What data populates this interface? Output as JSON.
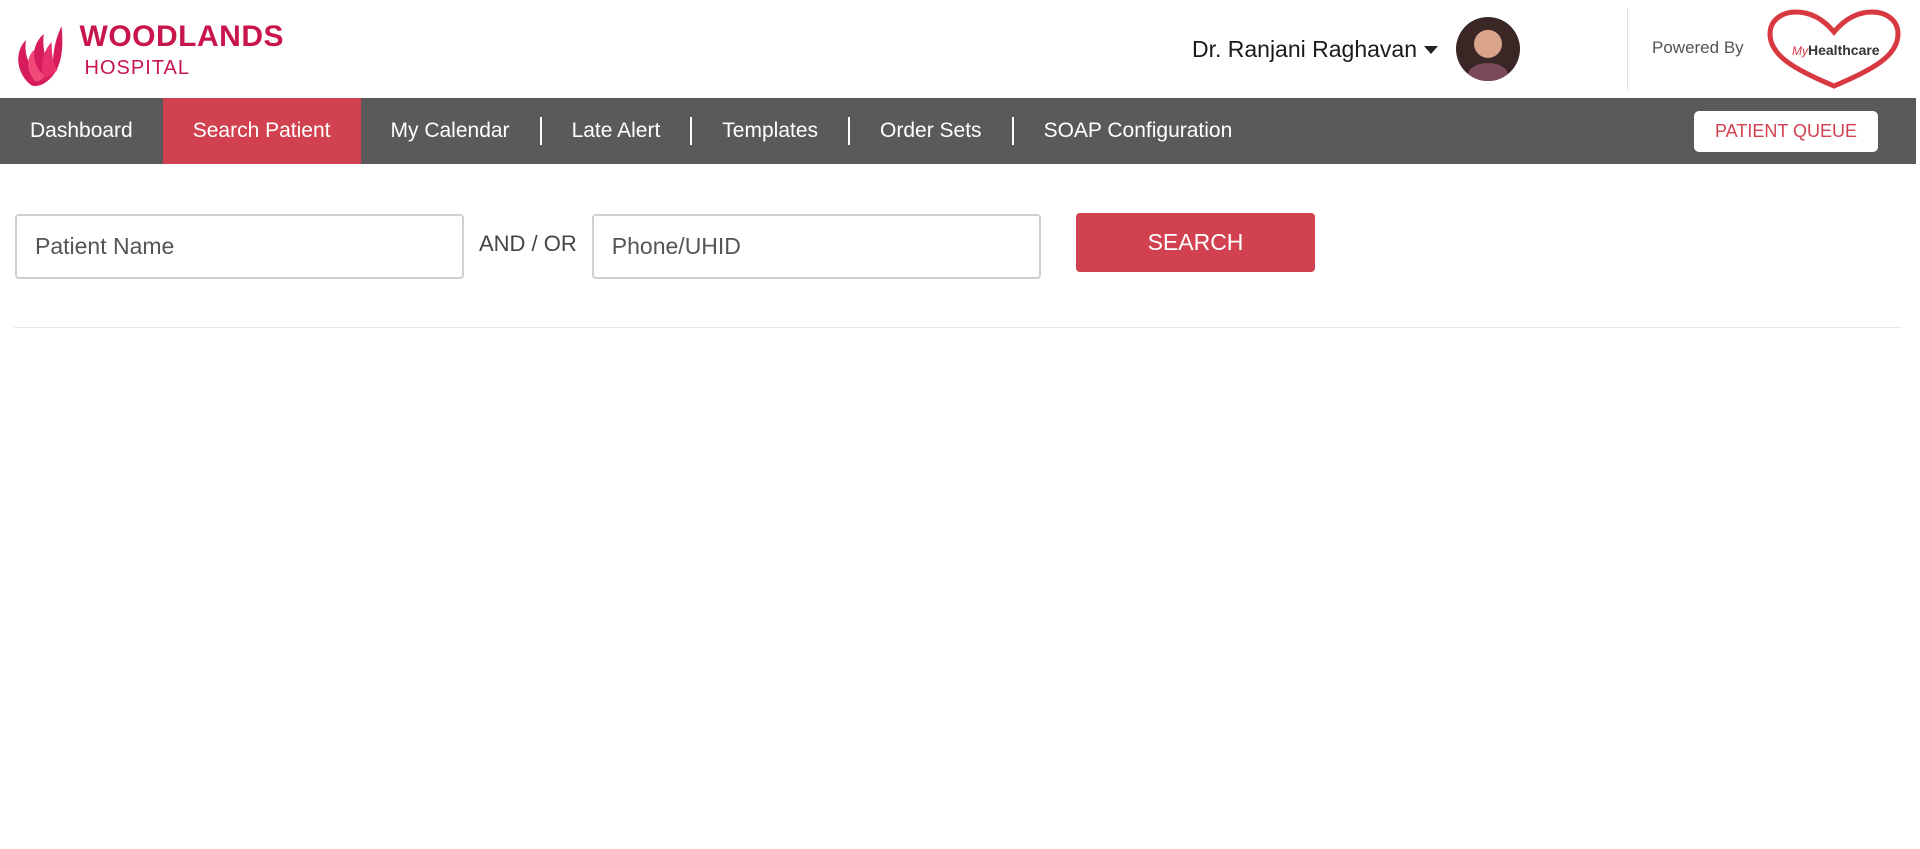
{
  "brand": {
    "name": "WOODLANDS",
    "subtitle": "HOSPITAL",
    "color": "#c8164c"
  },
  "user": {
    "name": "Dr. Ranjani Raghavan"
  },
  "powered_by": {
    "label": "Powered By",
    "partner_prefix": "My",
    "partner_name": "Healthcare"
  },
  "nav": {
    "items": [
      {
        "label": "Dashboard"
      },
      {
        "label": "Search Patient",
        "active": true
      },
      {
        "label": "My Calendar"
      },
      {
        "label": "Late Alert"
      },
      {
        "label": "Templates"
      },
      {
        "label": "Order Sets"
      },
      {
        "label": "SOAP Configuration"
      }
    ],
    "queue_label": "PATIENT QUEUE",
    "bar_color": "#5a5a5a",
    "accent_color": "#d24150"
  },
  "search": {
    "name_placeholder": "Patient Name",
    "name_value": "",
    "connector": "AND / OR",
    "phone_placeholder": "Phone/UHID",
    "phone_value": "",
    "button_label": "SEARCH"
  },
  "icons": {
    "caret": "chevron-down-icon",
    "avatar": "user-avatar",
    "brand": "woodlands-flame-logo",
    "partner": "myhealthcare-heart-logo"
  }
}
